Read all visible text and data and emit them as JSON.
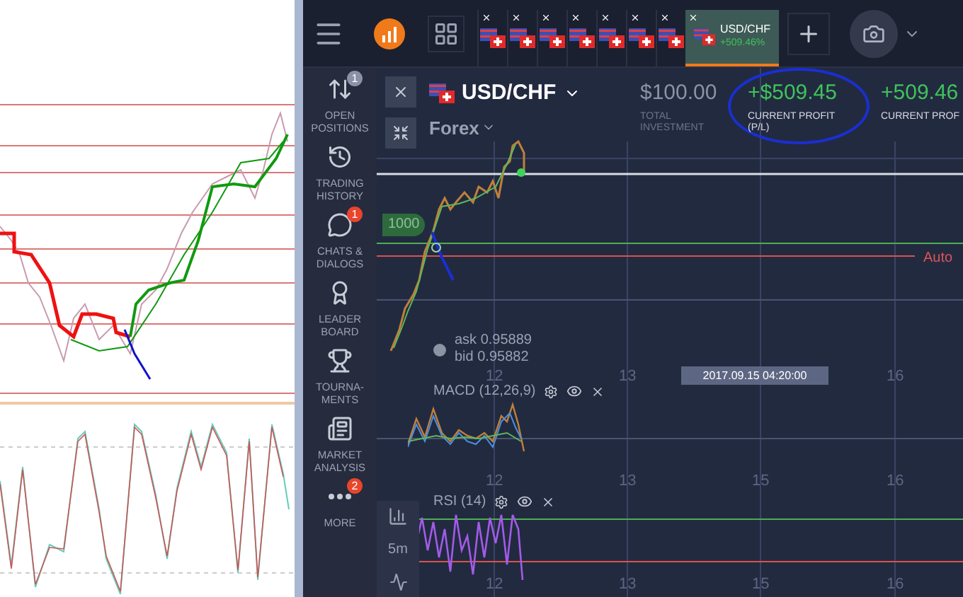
{
  "asset_tabs": [
    {
      "selected": false
    },
    {
      "selected": false
    },
    {
      "selected": false
    },
    {
      "selected": false
    },
    {
      "selected": false
    },
    {
      "selected": false
    },
    {
      "selected": false
    },
    {
      "selected": true,
      "label": "USD/CHF",
      "profit": "+509.46%"
    }
  ],
  "sidebar": {
    "items": [
      {
        "kind": "positions",
        "label": "OPEN POSITIONS",
        "badge": "1",
        "color": "#8a93a6"
      },
      {
        "kind": "history",
        "label": "TRADING HISTORY"
      },
      {
        "kind": "chats",
        "label": "CHATS & DIALOGS",
        "badge": "1",
        "color": "#e8452c"
      },
      {
        "kind": "leaderboard",
        "label": "LEADER BOARD"
      },
      {
        "kind": "tournaments",
        "label": "TOURNA- MENTS"
      },
      {
        "kind": "analysis",
        "label": "MARKET ANALYSIS"
      },
      {
        "kind": "more",
        "label": "MORE",
        "badge": "2",
        "color": "#e8452c"
      }
    ]
  },
  "asset": {
    "name": "USD/CHF",
    "market": "Forex"
  },
  "stats": [
    {
      "value": "$100.00",
      "label": "TOTAL INVESTMENT",
      "kind": "neutral",
      "circled": false
    },
    {
      "value": "+$509.45",
      "label": "CURRENT PROFIT (P/L)",
      "kind": "profit",
      "circled": true
    },
    {
      "value": "+509.46",
      "label": "CURRENT PROF",
      "kind": "profit",
      "circled": false
    }
  ],
  "chart": {
    "deal_amount": "1000",
    "auto_close_label": "Auto",
    "ask": "ask 0.95889",
    "bid": "bid 0.95882",
    "time_tooltip": "2017.09.15 04:20:00",
    "timeframe": "5m",
    "main_axis": [
      "12",
      "13",
      "16"
    ],
    "macd": {
      "label": "MACD (12,26,9)",
      "axis": [
        "12",
        "13",
        "15",
        "16"
      ]
    },
    "rsi": {
      "label": "RSI (14)",
      "axis": [
        "12",
        "13",
        "15",
        "16"
      ]
    }
  }
}
